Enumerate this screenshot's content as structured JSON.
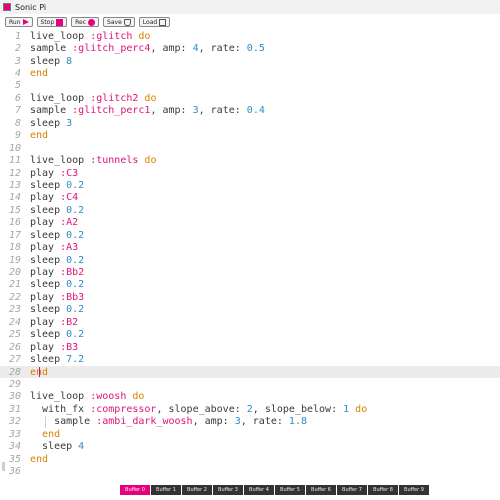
{
  "window": {
    "title": "Sonic Pi"
  },
  "toolbar": {
    "run_label": "Run",
    "stop_label": "Stop",
    "rec_label": "Rec",
    "save_label": "Save",
    "load_label": "Load"
  },
  "colors": {
    "accent": "#e5007e",
    "keyword": "#d87f00",
    "symbol": "#e0127d",
    "number": "#2d8ec6",
    "line_number": "#a6a6a6"
  },
  "editor": {
    "current_line": 28,
    "lines": [
      {
        "n": "1",
        "tokens": [
          [
            "t",
            "live_loop "
          ],
          [
            "sym",
            ":glitch"
          ],
          [
            "t",
            " "
          ],
          [
            "kw",
            "do"
          ]
        ]
      },
      {
        "n": "2",
        "tokens": [
          [
            "t",
            "sample "
          ],
          [
            "sym",
            ":glitch_perc4"
          ],
          [
            "t",
            ", amp: "
          ],
          [
            "num",
            "4"
          ],
          [
            "t",
            ", rate: "
          ],
          [
            "num",
            "0.5"
          ]
        ]
      },
      {
        "n": "3",
        "tokens": [
          [
            "t",
            "sleep "
          ],
          [
            "num",
            "8"
          ]
        ]
      },
      {
        "n": "4",
        "tokens": [
          [
            "kw",
            "end"
          ]
        ]
      },
      {
        "n": "5",
        "tokens": []
      },
      {
        "n": "6",
        "tokens": [
          [
            "t",
            "live_loop "
          ],
          [
            "sym",
            ":glitch2"
          ],
          [
            "t",
            " "
          ],
          [
            "kw",
            "do"
          ]
        ]
      },
      {
        "n": "7",
        "tokens": [
          [
            "t",
            "sample "
          ],
          [
            "sym",
            ":glitch_perc1"
          ],
          [
            "t",
            ", amp: "
          ],
          [
            "num",
            "3"
          ],
          [
            "t",
            ", rate: "
          ],
          [
            "num",
            "0.4"
          ]
        ]
      },
      {
        "n": "8",
        "tokens": [
          [
            "t",
            "sleep "
          ],
          [
            "num",
            "3"
          ]
        ]
      },
      {
        "n": "9",
        "tokens": [
          [
            "kw",
            "end"
          ]
        ]
      },
      {
        "n": "10",
        "tokens": []
      },
      {
        "n": "11",
        "tokens": [
          [
            "t",
            "live_loop "
          ],
          [
            "sym",
            ":tunnels"
          ],
          [
            "t",
            " "
          ],
          [
            "kw",
            "do"
          ]
        ]
      },
      {
        "n": "12",
        "tokens": [
          [
            "t",
            "play "
          ],
          [
            "sym",
            ":C3"
          ]
        ]
      },
      {
        "n": "13",
        "tokens": [
          [
            "t",
            "sleep "
          ],
          [
            "num",
            "0.2"
          ]
        ]
      },
      {
        "n": "14",
        "tokens": [
          [
            "t",
            "play "
          ],
          [
            "sym",
            ":C4"
          ]
        ]
      },
      {
        "n": "15",
        "tokens": [
          [
            "t",
            "sleep "
          ],
          [
            "num",
            "0.2"
          ]
        ]
      },
      {
        "n": "16",
        "tokens": [
          [
            "t",
            "play "
          ],
          [
            "sym",
            ":A2"
          ]
        ]
      },
      {
        "n": "17",
        "tokens": [
          [
            "t",
            "sleep "
          ],
          [
            "num",
            "0.2"
          ]
        ]
      },
      {
        "n": "18",
        "tokens": [
          [
            "t",
            "play "
          ],
          [
            "sym",
            ":A3"
          ]
        ]
      },
      {
        "n": "19",
        "tokens": [
          [
            "t",
            "sleep "
          ],
          [
            "num",
            "0.2"
          ]
        ]
      },
      {
        "n": "20",
        "tokens": [
          [
            "t",
            "play "
          ],
          [
            "sym",
            ":Bb2"
          ]
        ]
      },
      {
        "n": "21",
        "tokens": [
          [
            "t",
            "sleep "
          ],
          [
            "num",
            "0.2"
          ]
        ]
      },
      {
        "n": "22",
        "tokens": [
          [
            "t",
            "play "
          ],
          [
            "sym",
            ":Bb3"
          ]
        ]
      },
      {
        "n": "23",
        "tokens": [
          [
            "t",
            "sleep "
          ],
          [
            "num",
            "0.2"
          ]
        ]
      },
      {
        "n": "24",
        "tokens": [
          [
            "t",
            "play "
          ],
          [
            "sym",
            ":B2"
          ]
        ]
      },
      {
        "n": "25",
        "tokens": [
          [
            "t",
            "sleep "
          ],
          [
            "num",
            "0.2"
          ]
        ]
      },
      {
        "n": "26",
        "tokens": [
          [
            "t",
            "play "
          ],
          [
            "sym",
            ":B3"
          ]
        ]
      },
      {
        "n": "27",
        "tokens": [
          [
            "t",
            "sleep "
          ],
          [
            "num",
            "7.2"
          ]
        ]
      },
      {
        "n": "28",
        "tokens": [
          [
            "kw",
            "end"
          ]
        ]
      },
      {
        "n": "29",
        "tokens": []
      },
      {
        "n": "30",
        "tokens": [
          [
            "t",
            "live_loop "
          ],
          [
            "sym",
            ":woosh"
          ],
          [
            "t",
            " "
          ],
          [
            "kw",
            "do"
          ]
        ]
      },
      {
        "n": "31",
        "tokens": [
          [
            "t",
            "  with_fx "
          ],
          [
            "sym",
            ":compressor"
          ],
          [
            "t",
            ", slope_above: "
          ],
          [
            "num",
            "2"
          ],
          [
            "t",
            ", slope_below: "
          ],
          [
            "num",
            "1"
          ],
          [
            "t",
            " "
          ],
          [
            "kw",
            "do"
          ]
        ]
      },
      {
        "n": "32",
        "tokens": [
          [
            "t",
            "    sample "
          ],
          [
            "sym",
            ":ambi_dark_woosh"
          ],
          [
            "t",
            ", amp: "
          ],
          [
            "num",
            "3"
          ],
          [
            "t",
            ", rate: "
          ],
          [
            "num",
            "1.8"
          ]
        ]
      },
      {
        "n": "33",
        "tokens": [
          [
            "t",
            "  "
          ],
          [
            "kw",
            "end"
          ]
        ]
      },
      {
        "n": "34",
        "tokens": [
          [
            "t",
            "  sleep "
          ],
          [
            "num",
            "4"
          ]
        ]
      },
      {
        "n": "35",
        "tokens": [
          [
            "kw",
            "end"
          ]
        ]
      },
      {
        "n": "36",
        "tokens": []
      }
    ]
  },
  "buffers": {
    "active": 0,
    "tabs": [
      "Buffer 0",
      "Buffer 1",
      "Buffer 2",
      "Buffer 3",
      "Buffer 4",
      "Buffer 5",
      "Buffer 6",
      "Buffer 7",
      "Buffer 8",
      "Buffer 9"
    ]
  }
}
